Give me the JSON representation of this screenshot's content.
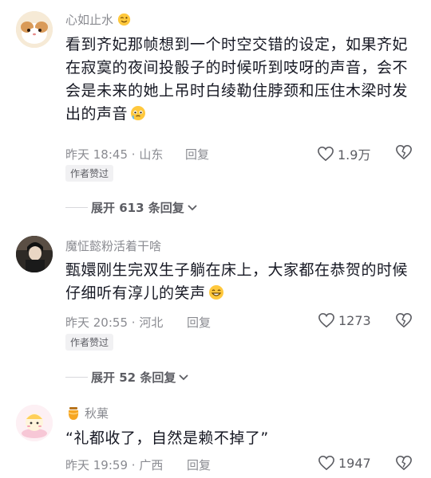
{
  "comments": [
    {
      "username": "心如止水",
      "text": "看到齐妃那帧想到一个时空交错的设定，如果齐妃在寂寞的夜间投骰子的时候听到吱呀的声音，会不会是未来的她上吊时白绫勒住脖颈和压住木梁时发出的声音",
      "time": "昨天 18:45",
      "location": "山东",
      "reply_label": "回复",
      "likes": "1.9万",
      "author_badge": "作者赞过",
      "expand_label": "展开 613 条回复"
    },
    {
      "username": "魔怔懿粉活着干啥",
      "text": "甄嬛刚生完双生子躺在床上，大家都在恭贺的时候仔细听有淳儿的笑声",
      "time": "昨天 20:55",
      "location": "河北",
      "reply_label": "回复",
      "likes": "1273",
      "author_badge": "作者赞过",
      "expand_label": "展开 52 条回复"
    },
    {
      "username": "秋菓",
      "text": "“礼都收了，自然是赖不掉了”",
      "time": "昨天 19:59",
      "location": "广西",
      "reply_label": "回复",
      "likes": "1947"
    }
  ],
  "icons": {
    "like": "heart-outline-icon",
    "dislike": "broken-heart-icon",
    "chevron": "chevron-down-icon",
    "emoji1": "wink-emoji-icon",
    "emoji2": "teary-emoji-icon",
    "emoji3": "grin-emoji-icon",
    "badge": "honey-jar-icon"
  },
  "colors": {
    "text_primary": "#161823",
    "text_secondary": "#8a8b91",
    "badge_bg": "#f1f1f3"
  }
}
